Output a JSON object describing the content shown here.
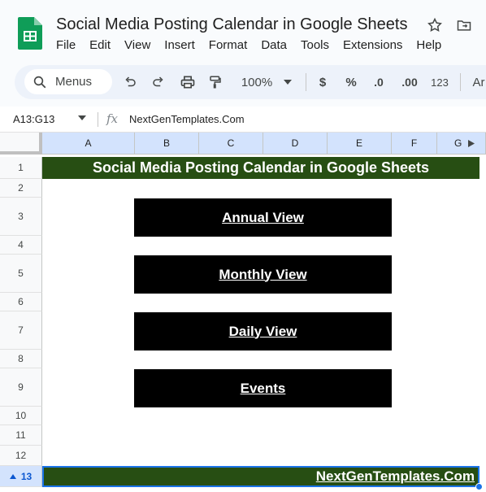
{
  "document": {
    "title": "Social Media Posting Calendar in Google Sheets"
  },
  "menu": [
    "File",
    "Edit",
    "View",
    "Insert",
    "Format",
    "Data",
    "Tools",
    "Extensions",
    "Help"
  ],
  "toolbar": {
    "search_label": "Menus",
    "zoom": "100%",
    "currency": "$",
    "percent": "%",
    "decrease_decimals": ".0",
    "increase_decimals": ".00",
    "number_format": "123",
    "font_partial": "Ar"
  },
  "formula_bar": {
    "name_box": "A13:G13",
    "fx": "fx",
    "value": "NextGenTemplates.Com"
  },
  "columns": [
    "A",
    "B",
    "C",
    "D",
    "E",
    "F",
    "G"
  ],
  "rows": [
    "1",
    "2",
    "3",
    "4",
    "5",
    "6",
    "7",
    "8",
    "9",
    "10",
    "11",
    "12",
    "13"
  ],
  "sheet": {
    "banner_title": "Social Media Posting Calendar in Google Sheets",
    "buttons": [
      "Annual View",
      "Monthly View",
      "Daily View",
      "Events"
    ],
    "footer_link": "NextGenTemplates.Com"
  },
  "colors": {
    "banner_green": "#274e13",
    "button_black": "#000000",
    "selection_blue": "#1a73e8",
    "header_blue": "#d3e3fd"
  },
  "icons": {
    "logo": "sheets-logo-icon",
    "star": "star-icon",
    "move": "move-to-folder-icon"
  }
}
